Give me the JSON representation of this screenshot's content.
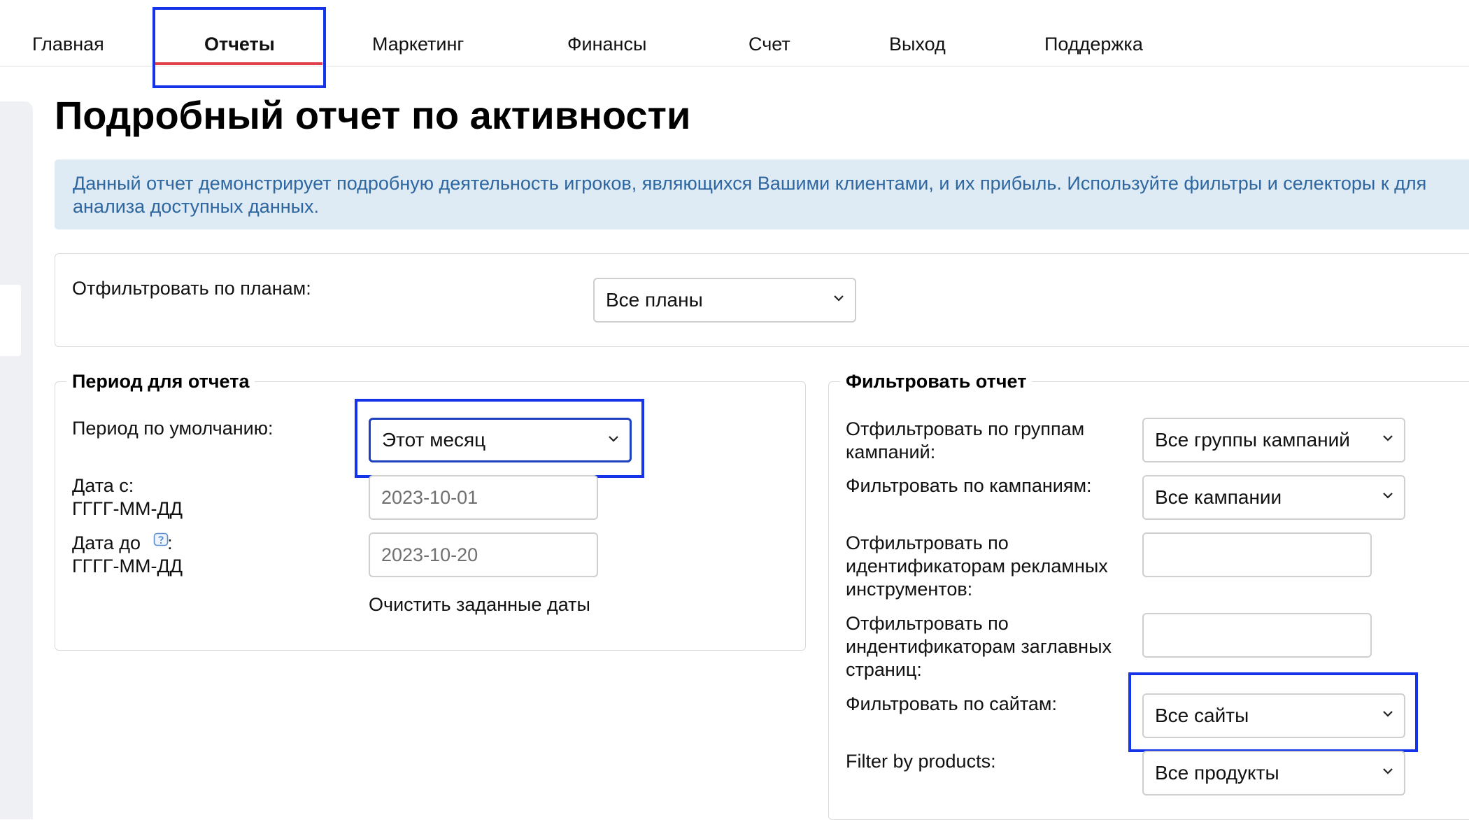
{
  "nav": {
    "items": [
      {
        "label": "Главная"
      },
      {
        "label": "Отчеты"
      },
      {
        "label": "Маркетинг"
      },
      {
        "label": "Финансы"
      },
      {
        "label": "Счет"
      },
      {
        "label": "Выход"
      },
      {
        "label": "Поддержка"
      }
    ],
    "active_index": 1
  },
  "page": {
    "title": "Подробный отчет по активности",
    "info": "Данный отчет демонстрирует подробную деятельность игроков, являющихся Вашими клиентами, и их прибыль. Используйте фильтры и селекторы к для анализа доступных данных."
  },
  "plans": {
    "label": "Отфильтровать по планам:",
    "selected": "Все планы"
  },
  "period": {
    "legend": "Период для отчета",
    "default_label": "Период по умолчанию:",
    "default_selected": "Этот месяц",
    "from_label": "Дата с:",
    "from_format": "ГГГГ-ММ-ДД",
    "from_value": "2023-10-01",
    "to_label": "Дата до",
    "to_format": "ГГГГ-ММ-ДД",
    "to_value": "2023-10-20",
    "clear_link": "Очистить заданные даты"
  },
  "filter": {
    "legend": "Фильтровать отчет",
    "campaign_groups_label": "Отфильтровать по группам кампаний:",
    "campaign_groups_selected": "Все группы кампаний",
    "campaigns_label": "Фильтровать по кампаниям:",
    "campaigns_selected": "Все кампании",
    "ad_tools_label": "Отфильтровать по идентификаторам рекламных инструментов:",
    "ad_tools_value": "",
    "landing_label": "Отфильтровать по индентификаторам заглавных страниц:",
    "landing_value": "",
    "sites_label": "Фильтровать по сайтам:",
    "sites_selected": "Все сайты",
    "products_label": "Filter by products:",
    "products_selected": "Все продукты"
  },
  "colors": {
    "accent_underline": "#e0404c",
    "highlight_box": "#1533e8",
    "info_bg": "#deeaf4",
    "info_text": "#2e67a0"
  },
  "icons": {
    "select_arrow": "chevron-down-icon",
    "help": "help-icon"
  }
}
